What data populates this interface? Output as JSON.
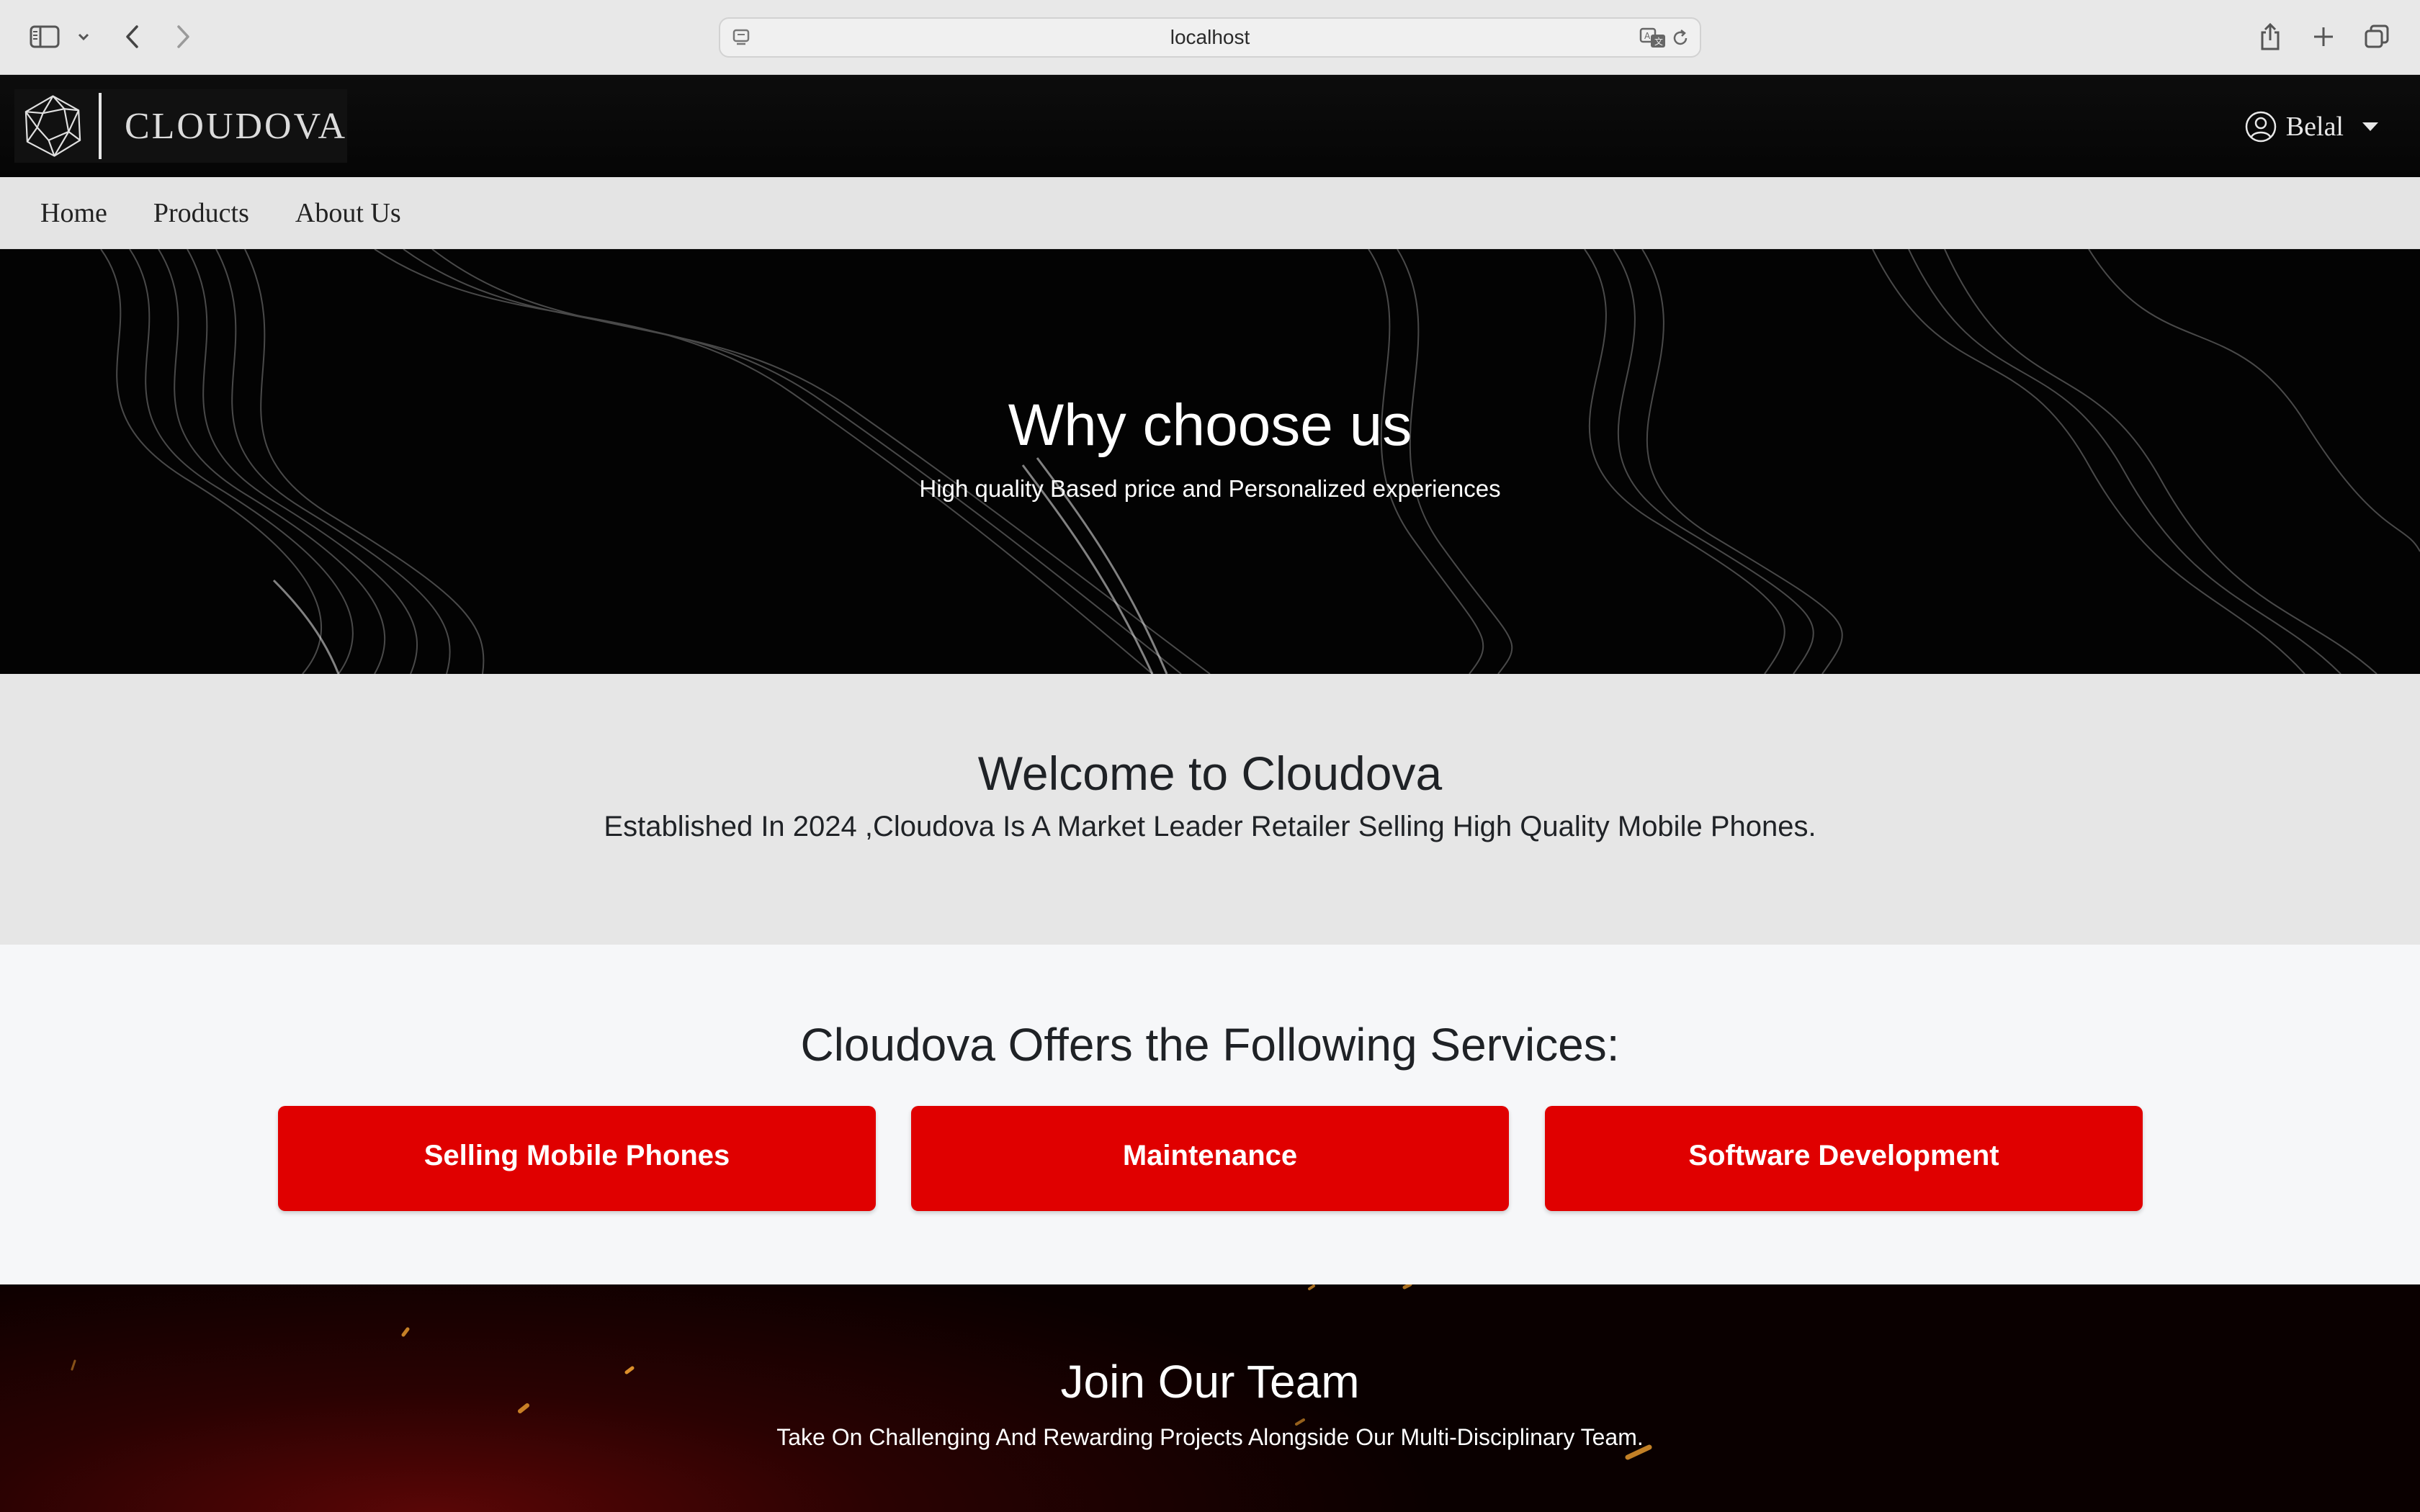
{
  "browser": {
    "url": "localhost",
    "icons": [
      "sidebar-icon",
      "chevron-down-icon",
      "back-arrow-icon",
      "forward-arrow-icon",
      "site-settings-icon",
      "translate-icon",
      "reload-icon",
      "share-icon",
      "plus-icon",
      "tabs-overview-icon"
    ]
  },
  "header": {
    "brand_name": "CLOUDOVA",
    "logo_icon": "polyhedron-logo-icon",
    "user": {
      "name": "Belal",
      "icon": "user-circle-icon"
    }
  },
  "nav": {
    "items": [
      {
        "label": "Home"
      },
      {
        "label": "Products"
      },
      {
        "label": "About Us"
      }
    ]
  },
  "hero": {
    "title": "Why choose us",
    "subtitle": "High quality Based price and Personalized experiences"
  },
  "welcome": {
    "title": "Welcome to Cloudova",
    "text": "Established In 2024 ,Cloudova Is A Market Leader Retailer Selling High Quality Mobile Phones."
  },
  "services": {
    "title": "Cloudova Offers the Following Services:",
    "items": [
      {
        "label": "Selling Mobile Phones"
      },
      {
        "label": "Maintenance"
      },
      {
        "label": "Software Development"
      }
    ]
  },
  "join": {
    "title": "Join Our Team",
    "text": "Take On Challenging And Rewarding Projects Alongside Our Multi-Disciplinary Team."
  },
  "colors": {
    "accent_red": "#e00000",
    "header_black": "#0a0a0a",
    "nav_gray": "#e4e4e4",
    "welcome_gray": "#e6e6e6",
    "page_bg": "#f6f7f9"
  }
}
